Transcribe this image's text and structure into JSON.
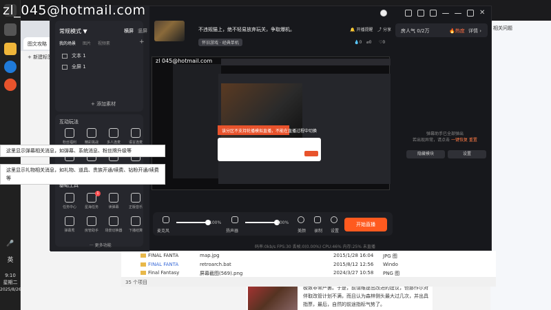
{
  "taskbar": {
    "language": "英",
    "time": "9:10",
    "weekday": "星期二",
    "date": "2025/8/26"
  },
  "browser": {
    "tab_title": "图文攻略",
    "new_tab": "新建标签",
    "side_panel_label": "相关问题",
    "article_text": "极致非常严罢。于是，前请维提出改进的建议，但那作尔对伴取改管计划不满，而且认为森林侧头最大过几次，并出具指票，最后，自然的前途指标气势了。"
  },
  "explorer": {
    "rows": [
      {
        "name": "FINAL FANTA",
        "file": "map.jpg",
        "date": "2015/1/28 16:04",
        "type": "JPG 图"
      },
      {
        "name": "FINAL FANTA",
        "file": "retroarch.bat",
        "date": "2015/8/12 12:56",
        "type": "Windo"
      },
      {
        "name": "Final Fantasy",
        "file": "屏幕截图(569).png",
        "date": "2024/3/27 10:58",
        "type": "PNG 图"
      }
    ],
    "status": "35 个项目"
  },
  "popups": {
    "note1": "这里显示弹幕相关消息，如弹幕、系统消息、粉丝牌升级等",
    "note2": "这里显示礼物相关消息，如礼物、道具、贵族开通/续费、钻粉开通/续费等"
  },
  "app": {
    "overlay_email": "zl_045@hotmail.com",
    "mode_label": "常规模式 ▼",
    "orientation": [
      "横屏",
      "竖屏"
    ],
    "scene_tabs": [
      "我的场景",
      "图片",
      "视频素"
    ],
    "scenes": [
      "文本 1",
      "全屏 1"
    ],
    "add_source": "+ 添加素材",
    "interactive_title": "互动玩法",
    "interactive_items": [
      "粉丝福利",
      "精彩挑战",
      "多人连麦",
      "语言连麦",
      "主播任务",
      "互动",
      "节奏投票",
      "粉丝团"
    ],
    "tools_title": "基础工具",
    "tool_items": [
      "任务中心",
      "星海任务",
      "读弹幕",
      "正版音乐",
      "弹幕秀",
      "房管助手",
      "场景切换器",
      "下播结算"
    ],
    "tool_badge": "1",
    "more_tools": "··· 更多功能",
    "room_title": "不违规猫上，绝不轻易放弃玩关，争取爆机。",
    "room_tag": "怀旧游戏 · 经典单机",
    "header_actions": [
      "开播提醒",
      "分享"
    ],
    "header_stats": [
      "0",
      "0",
      "0"
    ],
    "popularity_label": "房人气",
    "popularity_value": "0/2万",
    "hot_label": "热度",
    "detail_label": "详情 ›",
    "chat_notice": "弹幕助手已全部弹出",
    "chat_notice2": "若出现异常，请点击",
    "chat_link": "一键恢复",
    "chat_link2": "重置",
    "hide_module": "隐藏模块",
    "settings": "设置",
    "preview_mail": "zl 045@hotmail.com",
    "preview_red_text": "该分区不支持轮播模拟直播，不能在直播过程中切换",
    "mic_label": "麦克风",
    "mic_volume": "100%",
    "speaker_label": "扬声器",
    "speaker_volume": "100%",
    "ctrl_beauty": "美颜",
    "ctrl_record": "录制",
    "ctrl_settings": "设置",
    "start_button": "开始直播",
    "status_line": "码率:0kb/s   FPS:30   丢帧:0(0.00%)   CPU:46%   内存:25%   未直播"
  }
}
